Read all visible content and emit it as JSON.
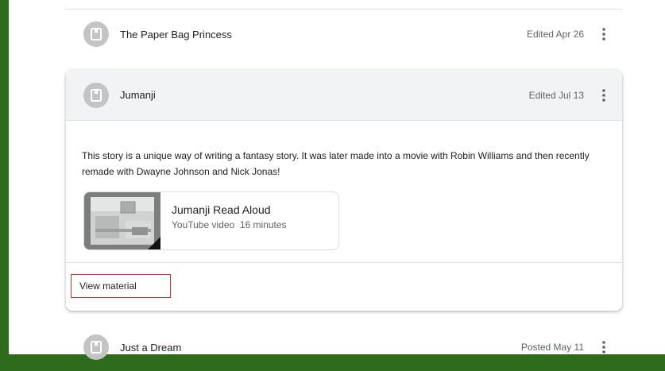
{
  "posts": [
    {
      "title": "The Paper Bag Princess",
      "meta": "Edited Apr 26"
    },
    {
      "title": "Jumanji",
      "meta": "Edited Jul 13"
    },
    {
      "title": "Just a Dream",
      "meta": "Posted May 11"
    }
  ],
  "expanded": {
    "description": "This story is a unique way of writing a fantasy story. It was later made into a movie with Robin Williams and then recently remade with Dwayne Johnson and Nick Jonas!",
    "attachment": {
      "title": "Jumanji Read Aloud",
      "subtitle": "YouTube video  16 minutes"
    },
    "view_label": "View material"
  },
  "colors": {
    "background_border": "#2e6b1c",
    "avatar": "#c4c4c4",
    "card_header": "#f1f3f4",
    "highlight": "#d93025"
  },
  "icons": {
    "avatar_icon": "bookmark-icon",
    "menu_icon": "more-vert-icon"
  }
}
